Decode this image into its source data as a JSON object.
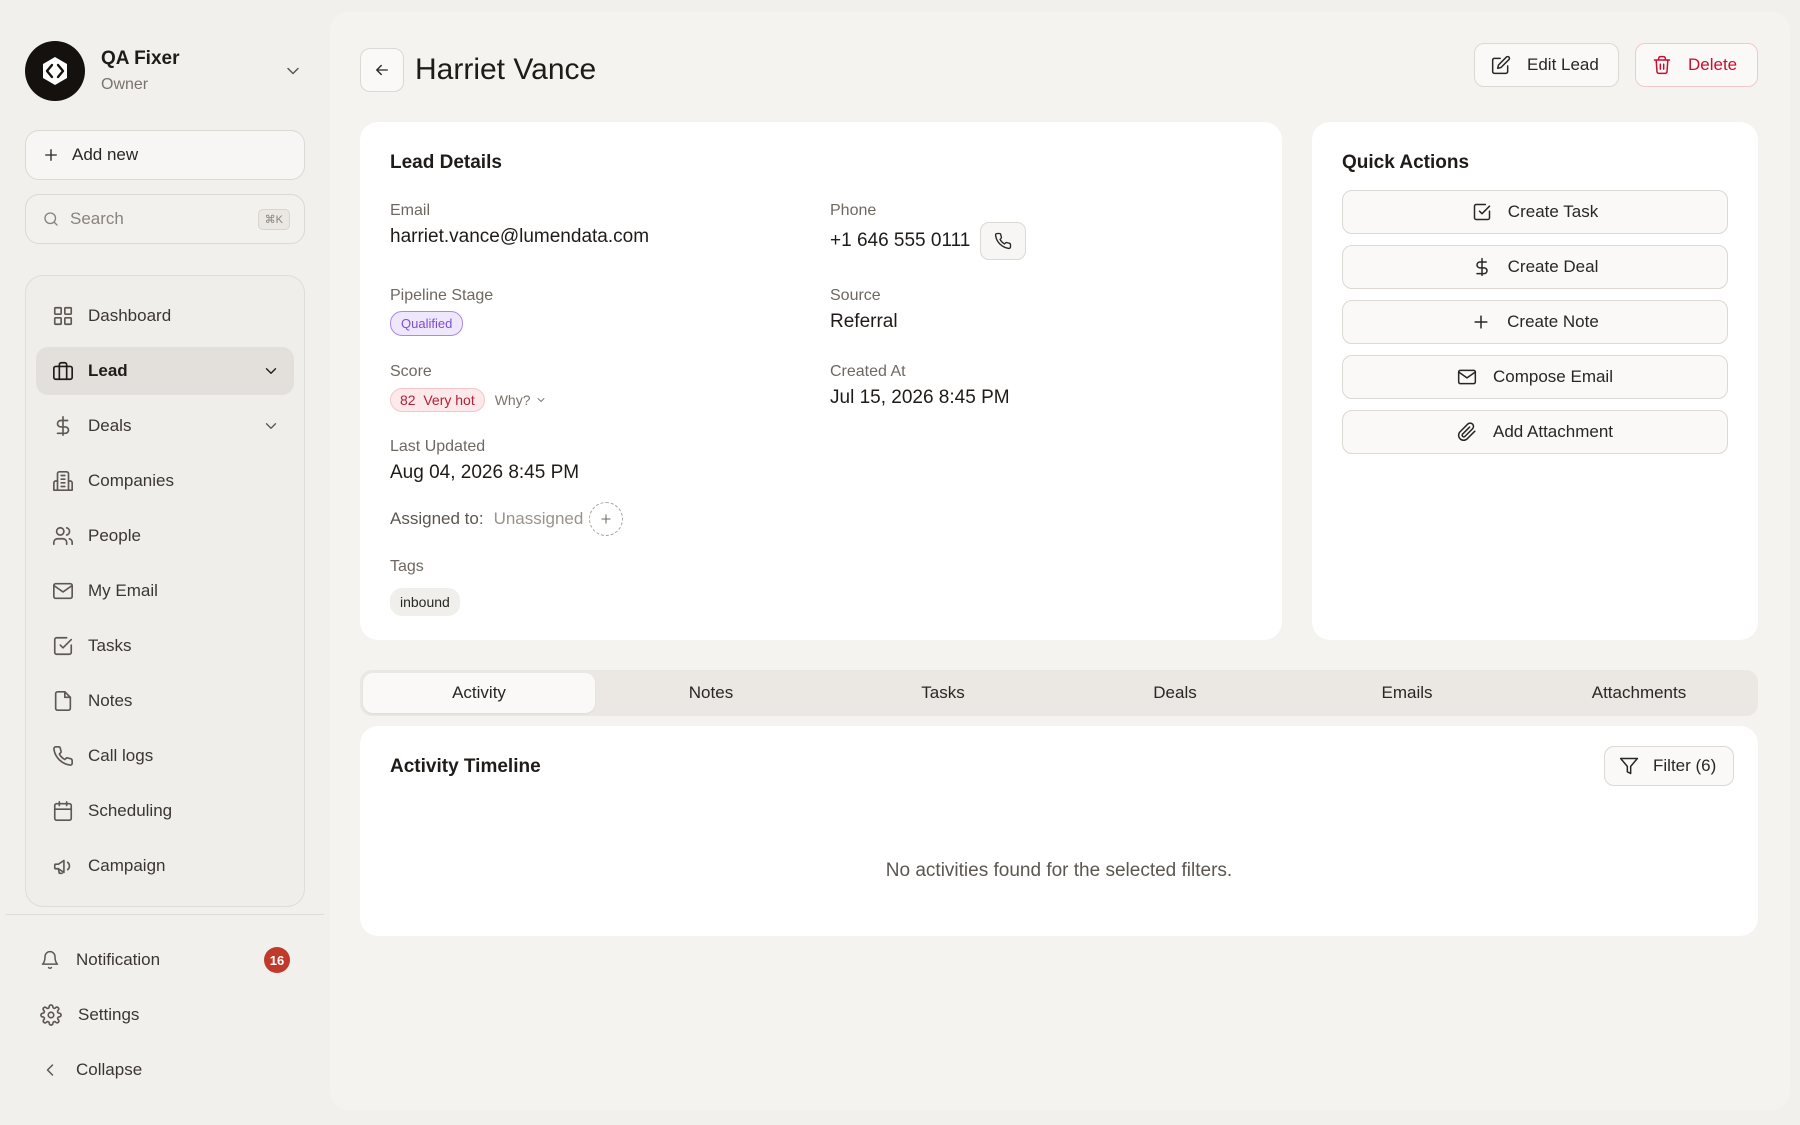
{
  "workspace": {
    "name": "QA Fixer",
    "role": "Owner"
  },
  "sidebar": {
    "add_new_label": "Add new",
    "search_placeholder": "Search",
    "search_shortcut": "⌘K",
    "items": [
      {
        "label": "Dashboard",
        "icon": "grid-icon"
      },
      {
        "label": "Lead",
        "icon": "briefcase-icon",
        "active": true,
        "expandable": true
      },
      {
        "label": "Deals",
        "icon": "dollar-icon",
        "expandable": true
      },
      {
        "label": "Companies",
        "icon": "building-icon"
      },
      {
        "label": "People",
        "icon": "users-icon"
      },
      {
        "label": "My Email",
        "icon": "mail-icon"
      },
      {
        "label": "Tasks",
        "icon": "checkbox-icon"
      },
      {
        "label": "Notes",
        "icon": "note-icon"
      },
      {
        "label": "Call logs",
        "icon": "phone-icon"
      },
      {
        "label": "Scheduling",
        "icon": "calendar-icon"
      },
      {
        "label": "Campaign",
        "icon": "megaphone-icon"
      }
    ],
    "notification_label": "Notification",
    "notification_count": "16",
    "settings_label": "Settings",
    "collapse_label": "Collapse"
  },
  "header": {
    "title": "Harriet Vance",
    "edit_label": "Edit Lead",
    "delete_label": "Delete"
  },
  "lead_details": {
    "title": "Lead Details",
    "email_label": "Email",
    "email": "harriet.vance@lumendata.com",
    "phone_label": "Phone",
    "phone": "+1 646 555 0111",
    "stage_label": "Pipeline Stage",
    "stage": "Qualified",
    "source_label": "Source",
    "source": "Referral",
    "score_label": "Score",
    "score": "82  Very hot",
    "why_label": "Why?",
    "created_label": "Created At",
    "created": "Jul 15, 2026 8:45 PM",
    "updated_label": "Last Updated",
    "updated": "Aug 04, 2026 8:45 PM",
    "assigned_label": "Assigned to:",
    "assigned": "Unassigned",
    "tags_label": "Tags",
    "tags": [
      "inbound"
    ]
  },
  "quick_actions": {
    "title": "Quick Actions",
    "items": [
      "Create Task",
      "Create Deal",
      "Create Note",
      "Compose Email",
      "Add Attachment"
    ]
  },
  "tabs": [
    "Activity",
    "Notes",
    "Tasks",
    "Deals",
    "Emails",
    "Attachments"
  ],
  "timeline": {
    "title": "Activity Timeline",
    "filter_label": "Filter (6)",
    "empty_text": "No activities found for the selected filters."
  },
  "colors": {
    "accent_stage": "#7b4fd6",
    "score_hot": "#b0213a",
    "danger": "#c8102e",
    "badge": "#c03a2b"
  }
}
